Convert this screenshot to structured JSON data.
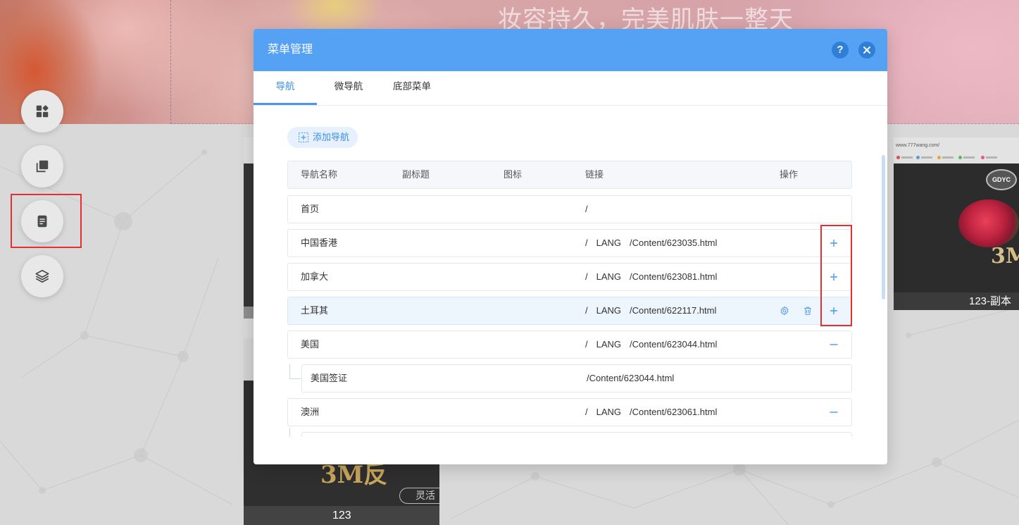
{
  "background": {
    "hero": {
      "slogan": "妆容持久，完美肌肤一整天"
    },
    "thumbnails": {
      "left_bottom": {
        "brand_text": "3M反",
        "tagline": "灵活",
        "label": "123"
      },
      "right": {
        "url": "www.777wang.com/",
        "logo_text": "GDYC",
        "brand_text": "3M",
        "label": "123-副本"
      }
    }
  },
  "sidebar": {
    "tools": [
      {
        "icon": "widgets-icon"
      },
      {
        "icon": "copy-icon"
      },
      {
        "icon": "page-icon"
      },
      {
        "icon": "layers-icon"
      }
    ]
  },
  "modal": {
    "title": "菜单管理",
    "help_glyph": "?",
    "close_icon": "close-icon",
    "tabs": [
      {
        "label": "导航",
        "active": true
      },
      {
        "label": "微导航",
        "active": false
      },
      {
        "label": "底部菜单",
        "active": false
      }
    ],
    "add_button": {
      "label": "添加导航",
      "icon": "plus-square-icon"
    },
    "columns": {
      "name": "导航名称",
      "subtitle": "副标题",
      "icon": "图标",
      "link": "链接",
      "actions": "操作"
    },
    "rows": [
      {
        "name": "首页",
        "link": [
          "/"
        ],
        "level": 1,
        "toggle": null
      },
      {
        "name": "中国香港",
        "link": [
          "/",
          "LANG",
          "/Content/623035.html"
        ],
        "level": 1,
        "toggle": "expand-icon"
      },
      {
        "name": "加拿大",
        "link": [
          "/",
          "LANG",
          "/Content/623081.html"
        ],
        "level": 1,
        "toggle": "expand-icon"
      },
      {
        "name": "土耳其",
        "link": [
          "/",
          "LANG",
          "/Content/622117.html"
        ],
        "level": 1,
        "toggle": "expand-icon",
        "hovered": true
      },
      {
        "name": "美国",
        "link": [
          "/",
          "LANG",
          "/Content/623044.html"
        ],
        "level": 1,
        "toggle": "collapse-icon"
      },
      {
        "name": "美国签证",
        "link": [
          "/Content/623044.html"
        ],
        "level": 2,
        "toggle": null
      },
      {
        "name": "澳洲",
        "link": [
          "/",
          "LANG",
          "/Content/623061.html"
        ],
        "level": 1,
        "toggle": "collapse-icon"
      }
    ],
    "hover_actions": [
      "settings-icon",
      "delete-icon"
    ]
  },
  "colors": {
    "header_bg": "#55a2f4",
    "accent": "#3b8ee8",
    "table_header_bg": "#f5f7fa",
    "row_hover_bg": "#eef6fd",
    "annotation_red": "#e53030"
  }
}
